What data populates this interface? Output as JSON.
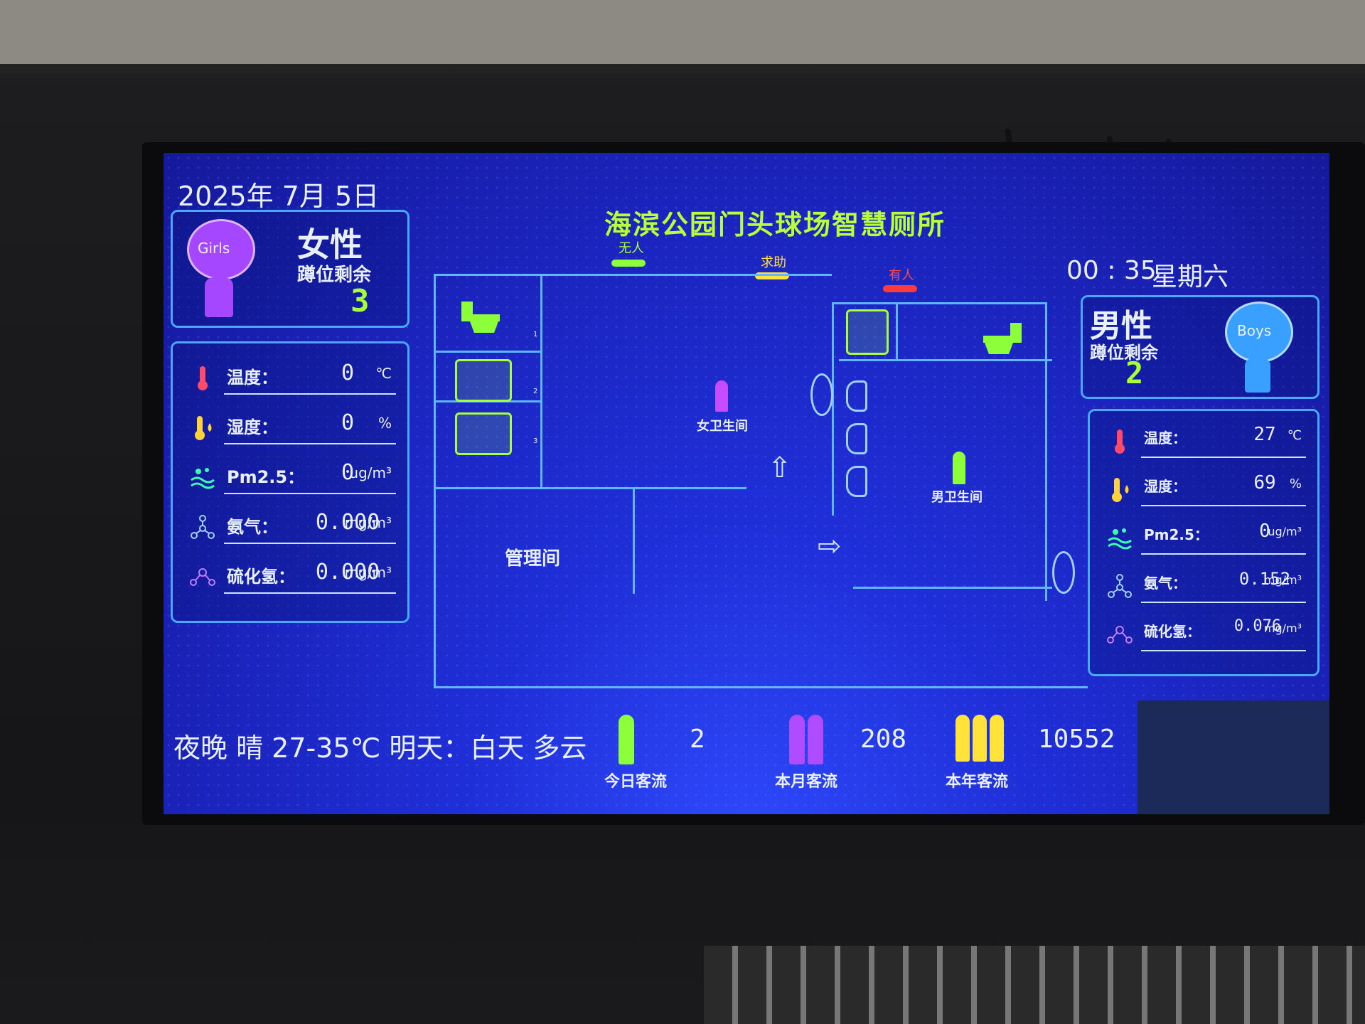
{
  "header": {
    "date": "2025年 7月 5日",
    "title": "海滨公园门头球场智慧厕所",
    "time": "00 : 35",
    "weekday": "星期六"
  },
  "legend": [
    {
      "label": "无人",
      "color": "#8cff3a"
    },
    {
      "label": "求助",
      "color": "#ffe23a"
    },
    {
      "label": "有人",
      "color": "#ff3a3a"
    }
  ],
  "female": {
    "avatar_text": "Girls",
    "gender_label": "女性",
    "remaining_label": "蹲位剩余",
    "remaining": "3",
    "metrics": [
      {
        "icon": "thermometer-icon",
        "label": "温度：",
        "value": "0",
        "unit": "℃"
      },
      {
        "icon": "humidity-icon",
        "label": "湿度：",
        "value": "0",
        "unit": "%"
      },
      {
        "icon": "pm25-icon",
        "label": "Pm2.5：",
        "value": "0",
        "unit": "ug/m³"
      },
      {
        "icon": "ammonia-icon",
        "label": "氨气：",
        "value": "0.000",
        "unit": "mg/m³"
      },
      {
        "icon": "h2s-icon",
        "label": "硫化氢：",
        "value": "0.000",
        "unit": "mg/m³"
      }
    ]
  },
  "male": {
    "avatar_text": "Boys",
    "gender_label": "男性",
    "remaining_label": "蹲位剩余",
    "remaining": "2",
    "metrics": [
      {
        "icon": "thermometer-icon",
        "label": "温度：",
        "value": "27",
        "unit": "℃"
      },
      {
        "icon": "humidity-icon",
        "label": "湿度：",
        "value": "69",
        "unit": "%"
      },
      {
        "icon": "pm25-icon",
        "label": "Pm2.5：",
        "value": "0",
        "unit": "ug/m³"
      },
      {
        "icon": "ammonia-icon",
        "label": "氨气：",
        "value": "0.152",
        "unit": "mg/m³"
      },
      {
        "icon": "h2s-icon",
        "label": "硫化氢：",
        "value": "0.076",
        "unit": "mg/m³"
      }
    ]
  },
  "floorplan": {
    "female_room": "女卫生间",
    "male_room": "男卫生间",
    "admin_room": "管理间",
    "stall_numbers": [
      "1",
      "2",
      "3"
    ]
  },
  "weather_ticker": "夜晚 晴 27-35℃ 明天：白天 多云",
  "visitor_flow": [
    {
      "label": "今日客流",
      "value": "2",
      "color": "#8cff3a"
    },
    {
      "label": "本月客流",
      "value": "208",
      "color": "#b04cff"
    },
    {
      "label": "本年客流",
      "value": "10552",
      "color": "#ffe23a"
    }
  ]
}
